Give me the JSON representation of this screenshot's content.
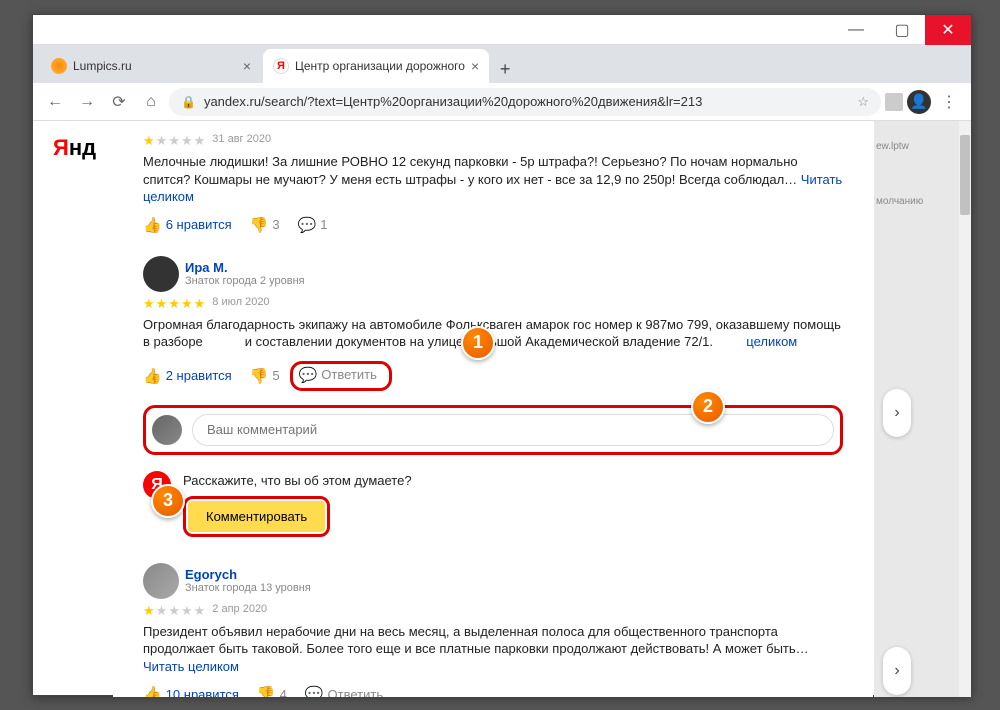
{
  "tabs": [
    {
      "title": "Lumpics.ru"
    },
    {
      "title": "Центр организации дорожного"
    }
  ],
  "url": "yandex.ru/search/?text=Центр%20организации%20дорожного%20движения&lr=213",
  "brand": {
    "y": "Я",
    "rest": "нд"
  },
  "sideHints": [
    "ew.lptw",
    "молчанию"
  ],
  "reviews": [
    {
      "date": "31 авг 2020",
      "ratingFilled": 1,
      "text": "Мелочные людишки! За лишние РОВНО 12 секунд парковки - 5р штрафа?! Серьезно? По ночам нормально спится? Кошмары не мучают? У меня есть штрафы - у кого их нет - все за 12,9 по 250р! Всегда соблюдал…",
      "readmore": "Читать целиком",
      "likes": "6 нравится",
      "dislikes": "3",
      "comments": "1"
    },
    {
      "name": "Ира М.",
      "level": "Знаток города 2 уровня",
      "date": "8 июл 2020",
      "ratingFilled": 5,
      "textPrefix": "Огромная благодарность экипажу на автомобиле Фольксваген амарок гос номер к 987мо 799, оказавшему помощь в разборе",
      "textSuffix": "и составлении документов на улице Большой Академической владение 72/1.",
      "readmore": "целиком",
      "likes": "2 нравится",
      "dislikes": "5",
      "reply": "Ответить"
    },
    {
      "name": "Egorych",
      "level": "Знаток города 13 уровня",
      "date": "2 апр 2020",
      "ratingFilled": 1,
      "text": "Президент объявил нерабочие дни на весь месяц, а выделенная полоса для общественного транспорта продолжает быть таковой. Более того еще и все платные парковки продолжают действовать! А может быть…",
      "readmore": "Читать целиком",
      "likes": "10 нравится",
      "dislikes": "4",
      "reply": "Ответить"
    }
  ],
  "comment": {
    "placeholder": "Ваш комментарий"
  },
  "prompt": {
    "question": "Расскажите, что вы об этом думаете?",
    "button": "Комментировать",
    "yaLetter": "Я"
  },
  "badges": [
    "1",
    "2",
    "3"
  ]
}
